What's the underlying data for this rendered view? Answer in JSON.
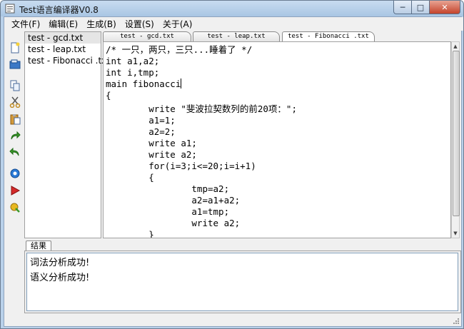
{
  "window": {
    "title": "Test语言编译器V0.8"
  },
  "menu": [
    {
      "label": "文件(F)"
    },
    {
      "label": "编辑(E)"
    },
    {
      "label": "生成(B)"
    },
    {
      "label": "设置(S)"
    },
    {
      "label": "关于(A)"
    }
  ],
  "toolbar_icons": [
    "new-file-icon",
    "open-file-icon",
    "copy-icon",
    "cut-icon",
    "paste-icon",
    "redo-icon",
    "undo-icon",
    "settings-gear-icon",
    "run-icon",
    "build-icon"
  ],
  "files": [
    {
      "name": "test - gcd.txt"
    },
    {
      "name": "test - leap.txt"
    },
    {
      "name": "test - Fibonacci .txt"
    }
  ],
  "tabs": [
    {
      "label": "test - gcd.txt"
    },
    {
      "label": "test - leap.txt"
    },
    {
      "label": "test - Fibonacci .txt"
    }
  ],
  "code": {
    "lines": [
      "/* 一只，两只，三只...睡着了 */",
      "int a1,a2;",
      "int i,tmp;",
      "main fibonacci",
      "{",
      "        write \"斐波拉契数列的前20项：\";",
      "        a1=1;",
      "        a2=2;",
      "        write a1;",
      "        write a2;",
      "        for(i=3;i<=20;i=i+1)",
      "        {",
      "                tmp=a2;",
      "                a2=a1+a2;",
      "                a1=tmp;",
      "                write a2;",
      "        }"
    ]
  },
  "result": {
    "tab_label": "结果",
    "lines": [
      "词法分析成功!",
      "语义分析成功!"
    ]
  },
  "colors": {
    "title_bar": "#b9d1ea",
    "close_button": "#c4432b"
  }
}
